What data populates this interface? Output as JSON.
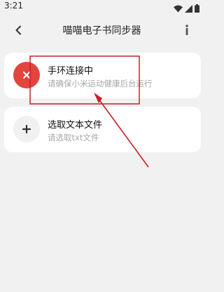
{
  "status_bar": {
    "time": "3:21",
    "icons": [
      "wifi-icon",
      "signal-icon",
      "battery-icon"
    ]
  },
  "header": {
    "title": "喵喵电子书同步器",
    "back_icon": "chevron-left-icon",
    "info_icon": "info-icon"
  },
  "cards": [
    {
      "title": "手环连接中",
      "subtitle": "请确保小米运动健康后台运行",
      "icon": "close-icon",
      "icon_color": "#e2453e"
    },
    {
      "title": "选取文本文件",
      "subtitle": "请选取txt文件",
      "icon": "plus-icon",
      "icon_color": "#f1f1f1"
    }
  ],
  "annotation_color": "#c8202a"
}
